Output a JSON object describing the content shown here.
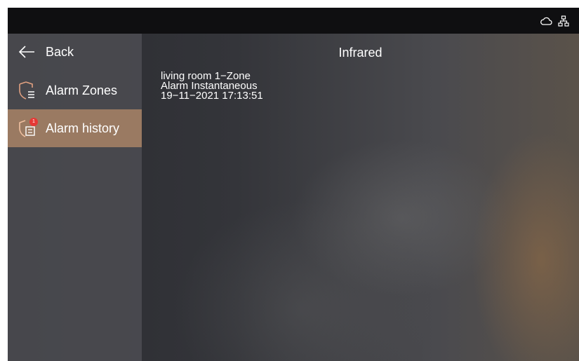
{
  "status_bar": {
    "icons": [
      "cloud-icon",
      "network-icon"
    ]
  },
  "sidebar": {
    "items": [
      {
        "label": "Back",
        "icon": "arrow-left-icon"
      },
      {
        "label": "Alarm Zones",
        "icon": "shield-list-icon"
      },
      {
        "label": "Alarm history",
        "icon": "shield-message-icon",
        "badge": "1",
        "selected": true
      }
    ]
  },
  "main": {
    "title": "Infrared",
    "event": {
      "line1": "living room  1−Zone",
      "line2": "Alarm  Instantaneous",
      "line3": "19−11−2021 17:13:51"
    }
  },
  "colors": {
    "selected_item": "#9a7a62",
    "badge": "#e53935",
    "statusbar": "#0f0f11"
  }
}
